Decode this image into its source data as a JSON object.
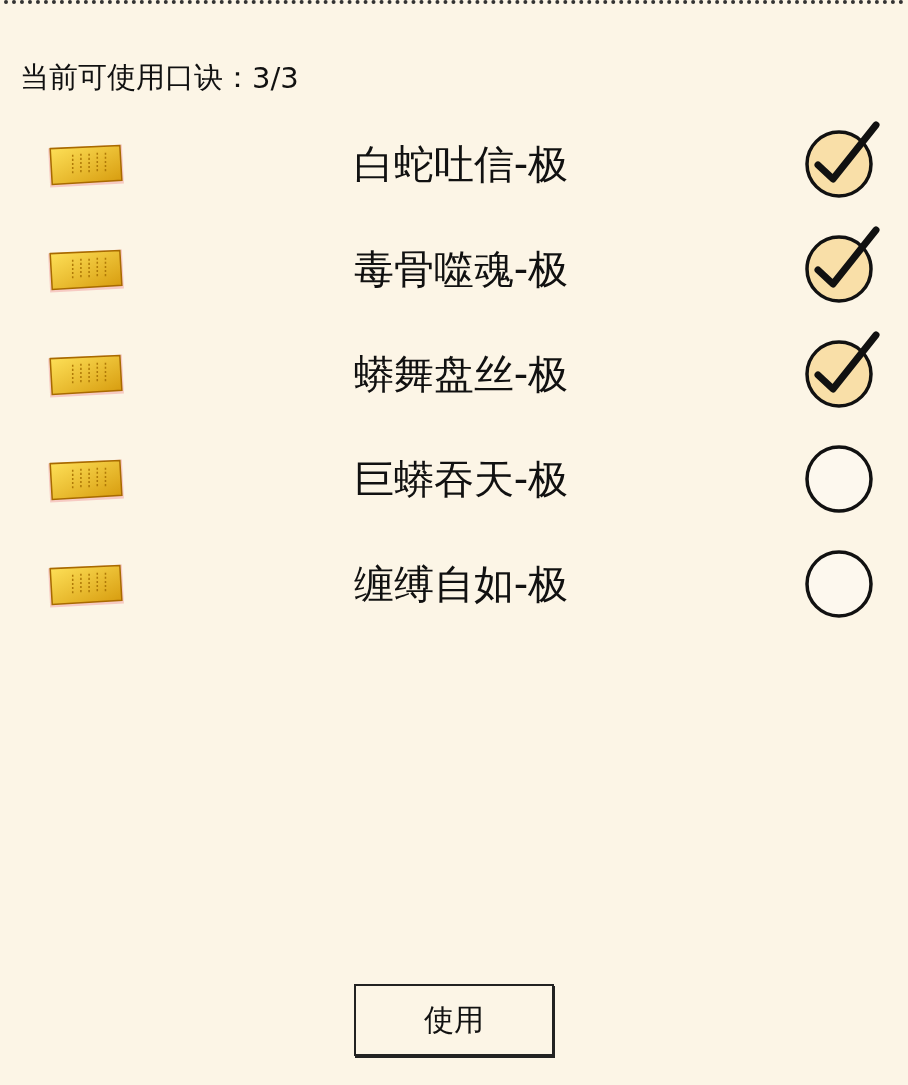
{
  "header": {
    "label": "当前可使用口诀：",
    "count": "3/3"
  },
  "skills": [
    {
      "name": "白蛇吐信-极",
      "checked": true
    },
    {
      "name": "毒骨噬魂-极",
      "checked": true
    },
    {
      "name": "蟒舞盘丝-极",
      "checked": true
    },
    {
      "name": "巨蟒吞天-极",
      "checked": false
    },
    {
      "name": "缠缚自如-极",
      "checked": false
    }
  ],
  "button": "使用"
}
